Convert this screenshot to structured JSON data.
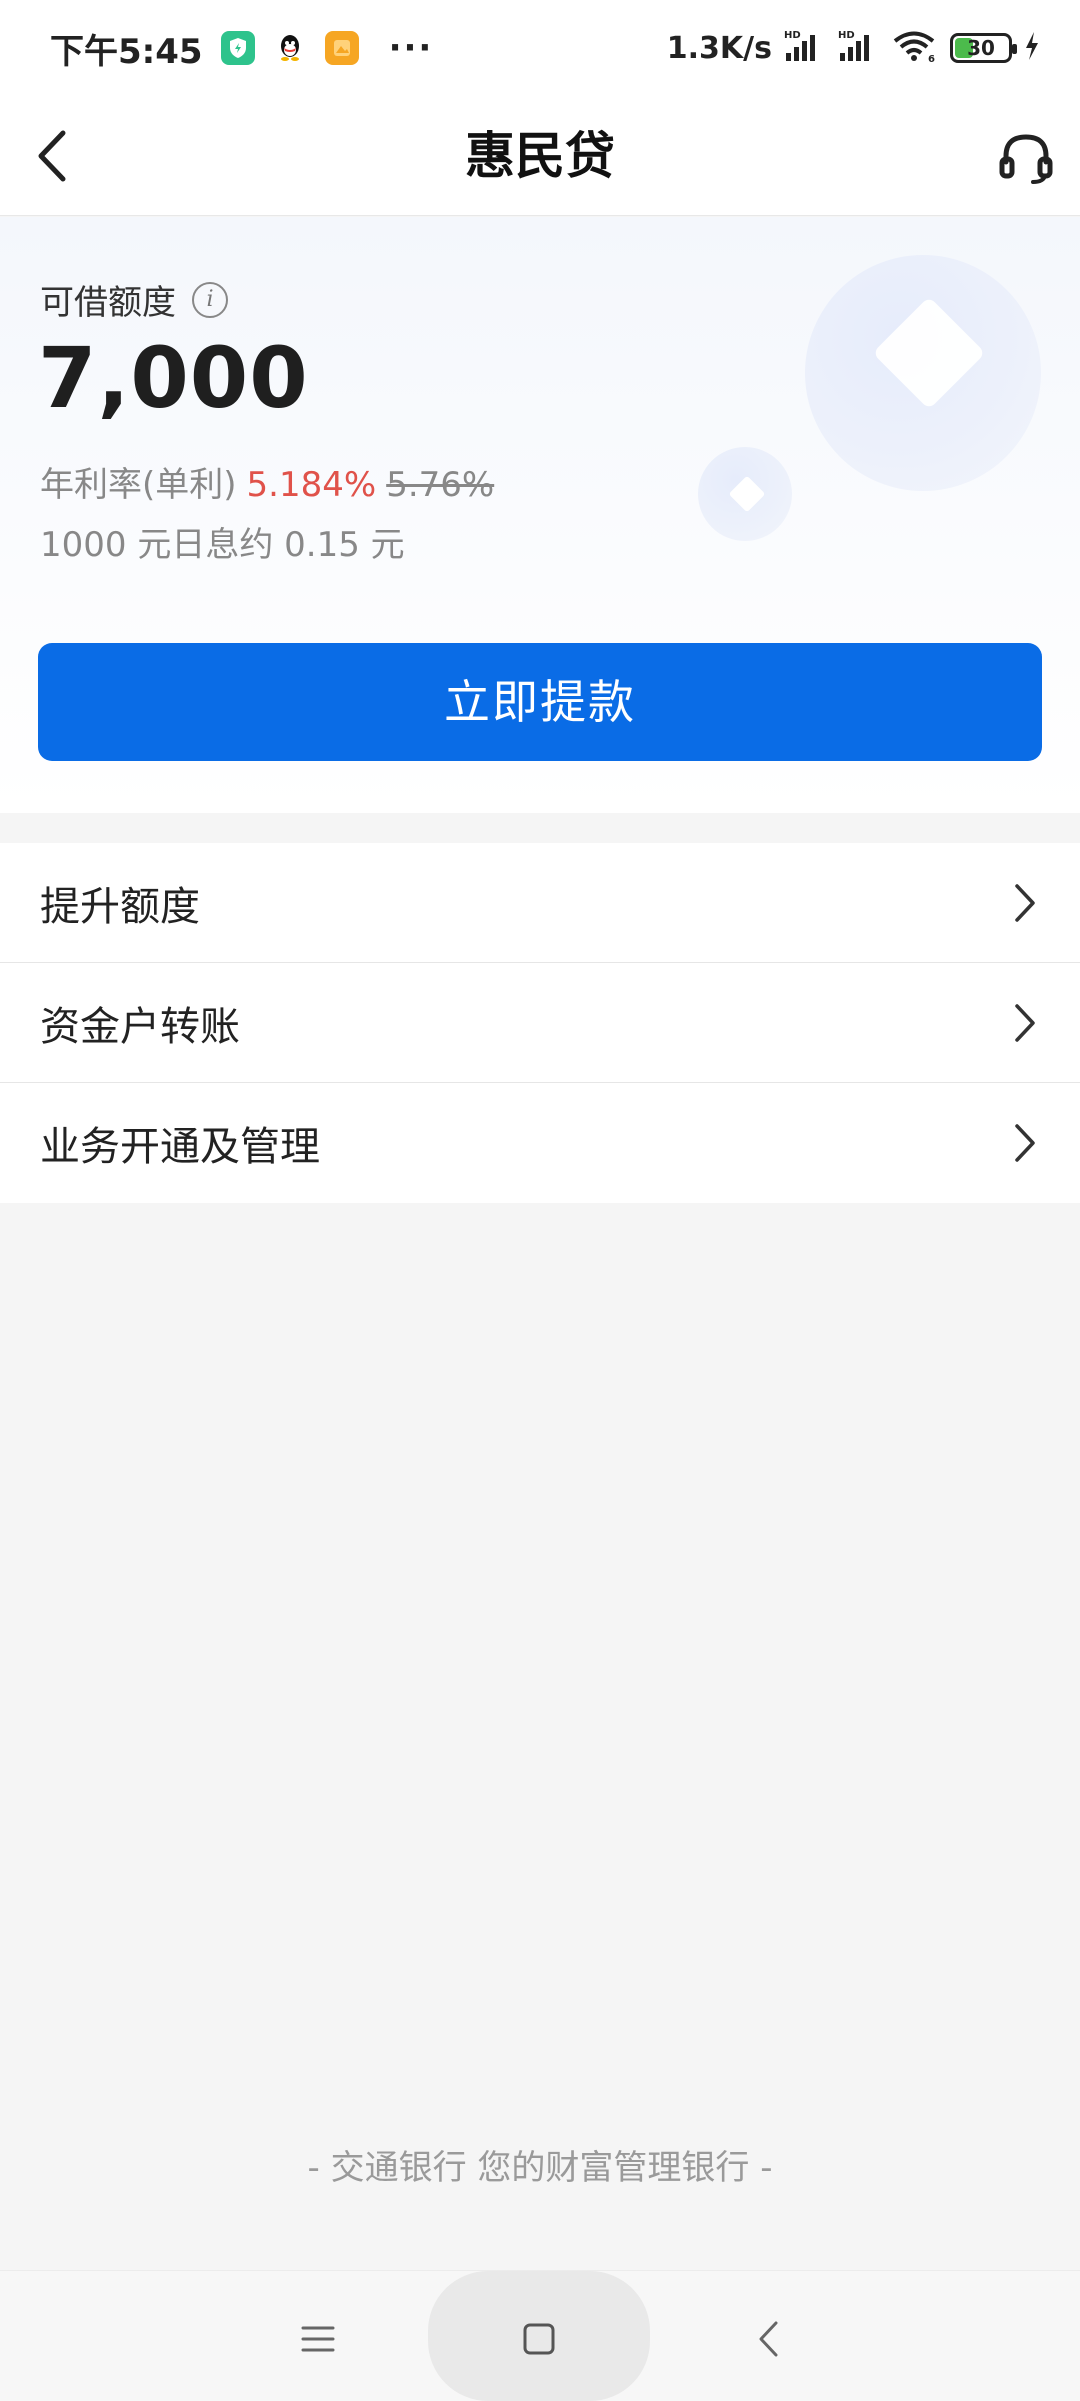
{
  "status_bar": {
    "time": "下午5:45",
    "network_speed": "1.3K/s",
    "battery_level": "30",
    "app_icons": [
      "shield-app-icon",
      "qq-icon",
      "gallery-app-icon"
    ],
    "overflow": "···",
    "signal_labels": [
      "HD",
      "HD"
    ],
    "wifi_label": "6"
  },
  "nav": {
    "title": "惠民贷"
  },
  "credit": {
    "label": "可借额度",
    "amount": "7,000",
    "rate_prefix": "年利率(单利)",
    "rate_current": "5.184%",
    "rate_original": "5.76%",
    "interest_note": "1000 元日息约 0.15 元"
  },
  "actions": {
    "withdraw_label": "立即提款"
  },
  "menu": {
    "items": [
      {
        "label": "提升额度"
      },
      {
        "label": "资金户转账"
      },
      {
        "label": "业务开通及管理"
      }
    ]
  },
  "footer": {
    "slogan": "- 交通银行 您的财富管理银行 -"
  },
  "colors": {
    "primary": "#0a6ce6",
    "rate_highlight": "#e0524a",
    "background": "#f5f5f5"
  }
}
